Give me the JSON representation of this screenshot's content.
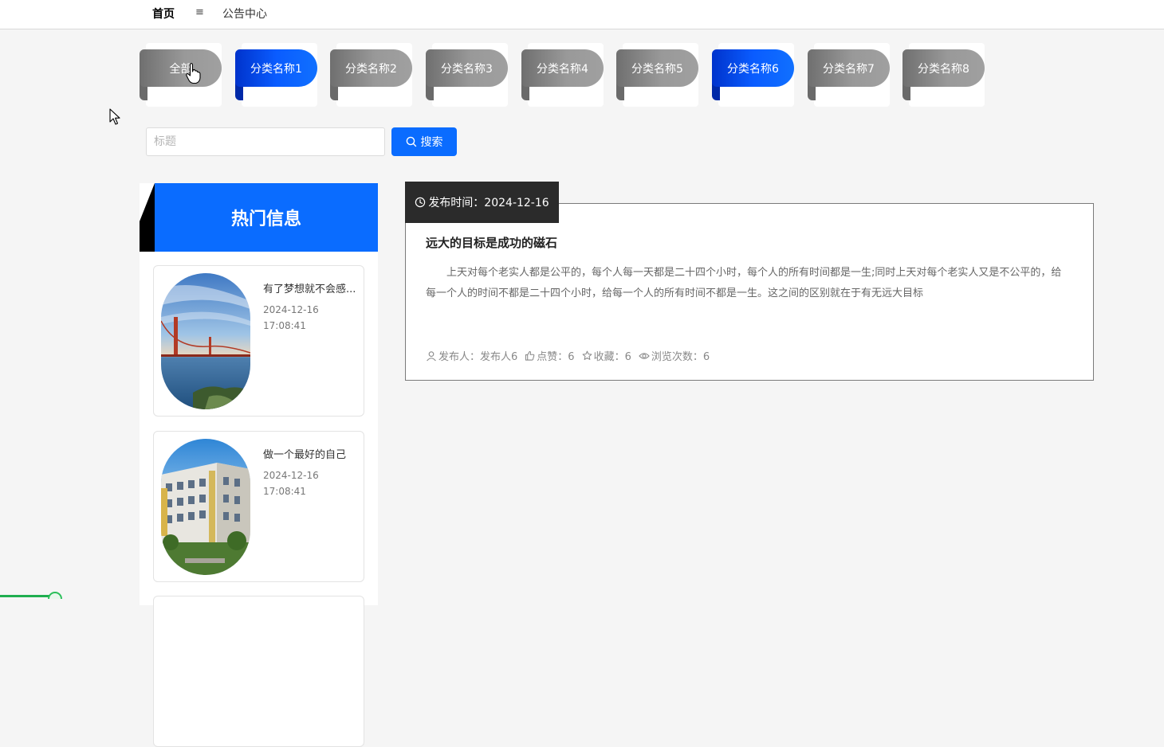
{
  "nav": {
    "home": "首页",
    "menu_icon": "≡",
    "notice_center": "公告中心"
  },
  "categories": [
    {
      "label": "全部",
      "active": false
    },
    {
      "label": "分类名称1",
      "active": true
    },
    {
      "label": "分类名称2",
      "active": false
    },
    {
      "label": "分类名称3",
      "active": false
    },
    {
      "label": "分类名称4",
      "active": false
    },
    {
      "label": "分类名称5",
      "active": false
    },
    {
      "label": "分类名称6",
      "active": true
    },
    {
      "label": "分类名称7",
      "active": false
    },
    {
      "label": "分类名称8",
      "active": false
    }
  ],
  "search": {
    "placeholder": "标题",
    "value": "",
    "button_label": "搜索"
  },
  "hot": {
    "title": "热门信息",
    "items": [
      {
        "title": "有了梦想就不会感...",
        "date": "2024-12-16",
        "time": "17:08:41",
        "image": "bridge-photo"
      },
      {
        "title": "做一个最好的自己",
        "date": "2024-12-16",
        "time": "17:08:41",
        "image": "building-photo"
      }
    ]
  },
  "article": {
    "date_label": "发布时间：2024-12-16",
    "title": "远大的目标是成功的磁石",
    "body": "上天对每个老实人都是公平的，每个人每一天都是二十四个小时，每个人的所有时间都是一生;同时上天对每个老实人又是不公平的，给每一个人的时间不都是二十四个小时，给每一个人的所有时间不都是一生。这之间的区别就在于有无远大目标",
    "publisher": "发布人：发布人6",
    "likes": "点赞：6",
    "favorites": "收藏：6",
    "views": "浏览次数：6"
  },
  "colors": {
    "accent": "#0a6cff",
    "inactive_tab": "#999999",
    "dark_tag": "#2b2b2b"
  }
}
